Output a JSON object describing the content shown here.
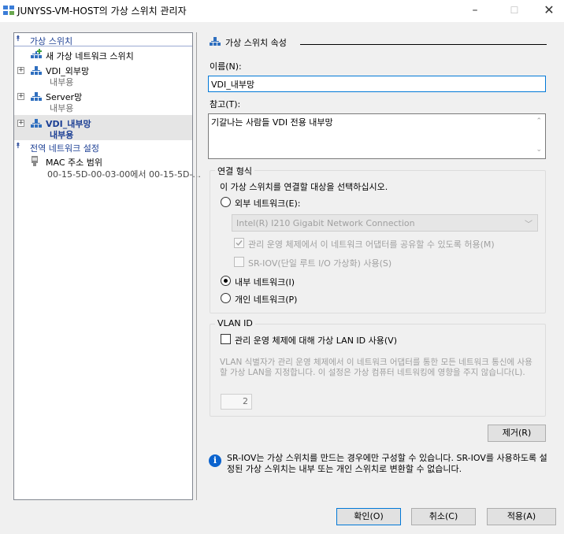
{
  "window": {
    "title": "JUNYSS-VM-HOST의 가상 스위치 관리자",
    "minimize_glyph": "–",
    "maximize_glyph": "☐",
    "close_glyph": "✕"
  },
  "sidebar": {
    "section_switches": "가상 스위치",
    "new_switch": "새 가상 네트워크 스위치",
    "switches": [
      {
        "name": "VDI_외부망",
        "type": "내부용",
        "selected": false
      },
      {
        "name": "Server망",
        "type": "내부용",
        "selected": false
      },
      {
        "name": "VDI_내부망",
        "type": "내부용",
        "selected": true
      }
    ],
    "section_global": "전역 네트워크 설정",
    "mac_title": "MAC 주소 범위",
    "mac_value": "00-15-5D-00-03-00에서 00-15-5D-..."
  },
  "properties": {
    "header": "가상 스위치 속성",
    "name_label": "이름(N):",
    "name_value": "VDI_내부망",
    "notes_label": "참고(T):",
    "notes_value": "기갈나는 사람들 VDI 전용 내부망",
    "connection": {
      "legend": "연결 형식",
      "instruction": "이 가상 스위치를 연결할 대상을 선택하십시오.",
      "external_label": "외부 네트워크(E):",
      "adapter_value": "Intel(R) I210 Gigabit Network Connection",
      "share_label": "관리 운영 체제에서 이 네트워크 어댑터를 공유할 수 있도록 허용(M)",
      "sriov_label": "SR-IOV(단일 루트 I/O 가상화) 사용(S)",
      "internal_label": "내부 네트워크(I)",
      "private_label": "개인 네트워크(P)",
      "selected": "internal"
    },
    "vlan": {
      "legend": "VLAN ID",
      "enable_label": "관리 운영 체제에 대해 가상 LAN ID 사용(V)",
      "description": "VLAN 식별자가 관리 운영 체제에서 이 네트워크 어댑터를 통한 모든 네트워크 통신에 사용할 가상 LAN을 지정합니다. 이 설정은 가상 컴퓨터 네트워킹에 영향을 주지 않습니다(L).",
      "value": "2"
    },
    "remove_button": "제거(R)",
    "info_text": "SR-IOV는 가상 스위치를 만드는 경우에만 구성할 수 있습니다. SR-IOV를 사용하도록 설정된 가상 스위치는 내부 또는 개인 스위치로 변환할 수 없습니다."
  },
  "footer": {
    "ok": "확인(O)",
    "cancel": "취소(C)",
    "apply": "적용(A)"
  },
  "icons": {
    "app": "virtual-switch-manager-icon",
    "network": "network-switch-icon",
    "new_switch": "add-network-switch-icon",
    "mac": "network-adapter-icon",
    "info": "info-icon"
  },
  "colors": {
    "accent": "#1c3f94",
    "focus": "#0078d7",
    "info": "#0b63ce",
    "selection": "#e5e5e5"
  }
}
